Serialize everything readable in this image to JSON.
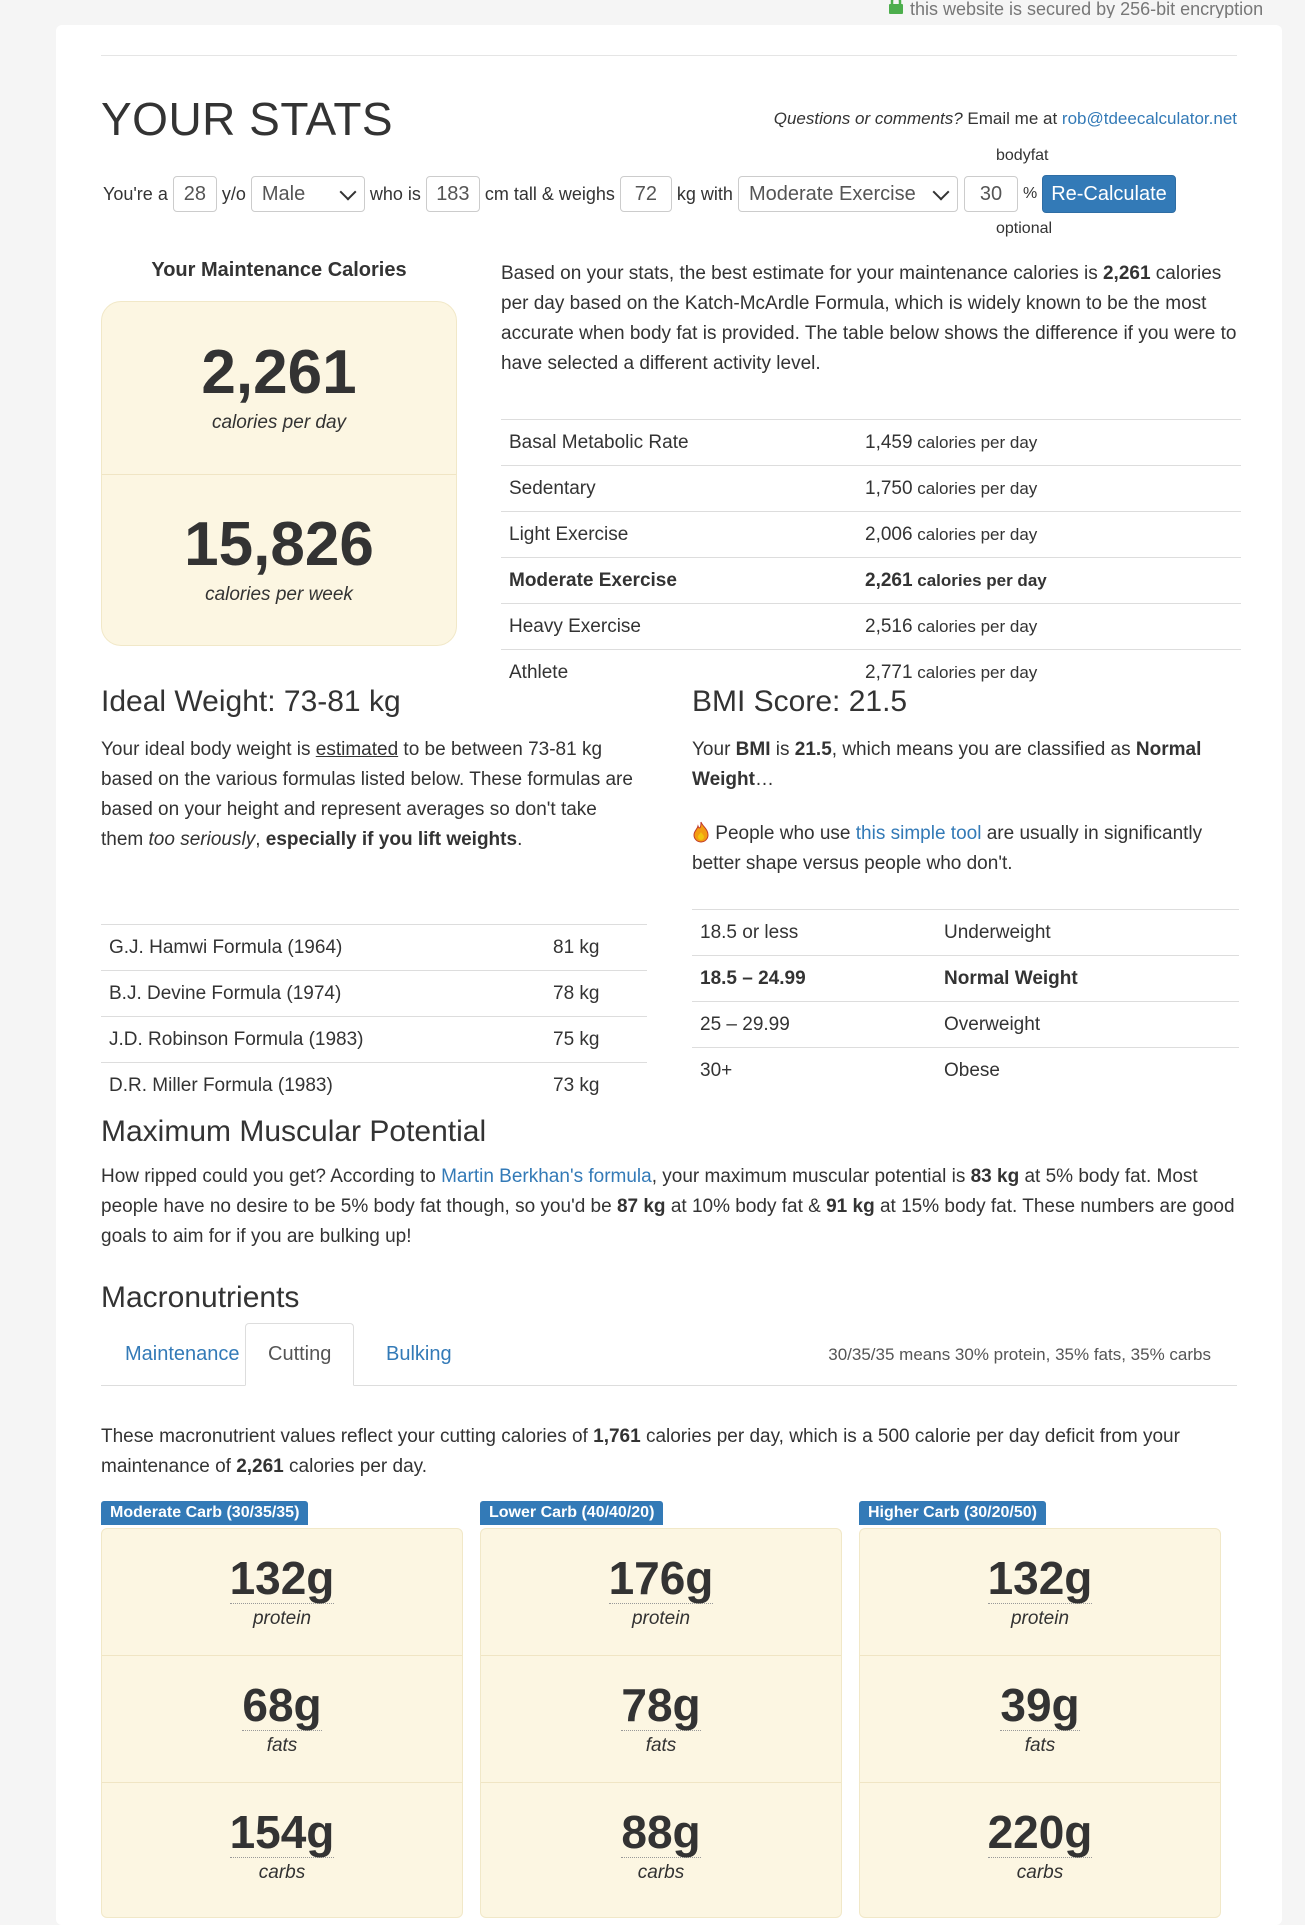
{
  "secure_text": "this website is secured by 256-bit encryption",
  "header": {
    "title": "YOUR STATS",
    "contact_italic": "Questions or comments?",
    "contact_text": " Email me at ",
    "contact_email": "rob@tdeecalculator.net"
  },
  "form": {
    "youre_a": "You're a",
    "age": "28",
    "yo": "y/o",
    "gender": "Male",
    "who_is": "who is",
    "height": "183",
    "cm_tall": "cm tall & weighs",
    "weight": "72",
    "kg_with": "kg with",
    "activity": "Moderate Exercise",
    "bodyfat_label": "bodyfat",
    "bodyfat": "30",
    "percent": "%",
    "optional_label": "optional",
    "recalc_label": "Re-Calculate"
  },
  "maintenance": {
    "title": "Your Maintenance Calories",
    "per_day": "2,261",
    "per_day_label": "calories per day",
    "per_week": "15,826",
    "per_week_label": "calories per week",
    "intro_1": "Based on your stats, the best estimate for your maintenance calories is ",
    "intro_bold": "2,261",
    "intro_2": " calories per day based on the Katch-McArdle Formula, which is widely known to be the most accurate when body fat is provided. The table below shows the difference if you were to have selected a different activity level.",
    "rows": [
      {
        "name": "Basal Metabolic Rate",
        "value": "1,459",
        "unit": " calories per day"
      },
      {
        "name": "Sedentary",
        "value": "1,750",
        "unit": " calories per day"
      },
      {
        "name": "Light Exercise",
        "value": "2,006",
        "unit": " calories per day"
      },
      {
        "name": "Moderate Exercise",
        "value": "2,261",
        "unit": " calories per day"
      },
      {
        "name": "Heavy Exercise",
        "value": "2,516",
        "unit": " calories per day"
      },
      {
        "name": "Athlete",
        "value": "2,771",
        "unit": " calories per day"
      }
    ]
  },
  "ideal": {
    "title": "Ideal Weight: 73-81 kg",
    "p1": "Your ideal body weight is ",
    "p_estimated": "estimated",
    "p2": " to be between 73-81 kg based on the various formulas listed below. These formulas are based on your height and represent averages so don't take them ",
    "p_italic": "too seriously",
    "p3": ", ",
    "p_bold": "especially if you lift weights",
    "p4": ".",
    "rows": [
      {
        "name": "G.J. Hamwi Formula (1964)",
        "value": "81 kg"
      },
      {
        "name": "B.J. Devine Formula (1974)",
        "value": "78 kg"
      },
      {
        "name": "J.D. Robinson Formula (1983)",
        "value": "75 kg"
      },
      {
        "name": "D.R. Miller Formula (1983)",
        "value": "73 kg"
      }
    ]
  },
  "bmi": {
    "title": "BMI Score: 21.5",
    "p1": "Your ",
    "p_bmi": "BMI",
    "p2": " is ",
    "p_score": "21.5",
    "p3": ", which means you are classified as ",
    "p_class": "Normal Weight",
    "p4": "…",
    "tool_1": " People who use ",
    "tool_link": "this simple tool",
    "tool_2": " are usually in significantly better shape versus people who don't.",
    "rows": [
      {
        "range": "18.5 or less",
        "label": "Underweight"
      },
      {
        "range": "18.5 – 24.99",
        "label": "Normal Weight"
      },
      {
        "range": "25 – 29.99",
        "label": "Overweight"
      },
      {
        "range": "30+",
        "label": "Obese"
      }
    ]
  },
  "muscular": {
    "title": "Maximum Muscular Potential",
    "p1": "How ripped could you get? According to ",
    "p_link": "Martin Berkhan's formula",
    "p2": ", your maximum muscular potential is ",
    "v1": "83 kg",
    "p3": " at 5% body fat. Most people have no desire to be 5% body fat though, so you'd be ",
    "v2": "87 kg",
    "p4": " at 10% body fat & ",
    "v3": "91 kg",
    "p5": " at 15% body fat. These numbers are good goals to aim for if you are bulking up!"
  },
  "macros": {
    "title": "Macronutrients",
    "tabs": [
      "Maintenance",
      "Cutting",
      "Bulking"
    ],
    "tab_note": "30/35/35 means 30% protein, 35% fats, 35% carbs",
    "p1": "These macronutrient values reflect your cutting calories of ",
    "b1": "1,761",
    "p2": " calories per day, which is a 500 calorie per day deficit from your maintenance of ",
    "b2": "2,261",
    "p3": " calories per day.",
    "columns": [
      {
        "label": "Moderate Carb (30/35/35)",
        "protein": "132g",
        "fats": "68g",
        "carbs": "154g"
      },
      {
        "label": "Lower Carb (40/40/20)",
        "protein": "176g",
        "fats": "78g",
        "carbs": "88g"
      },
      {
        "label": "Higher Carb (30/20/50)",
        "protein": "132g",
        "fats": "39g",
        "carbs": "220g"
      }
    ],
    "protein_label": "protein",
    "fats_label": "fats",
    "carbs_label": "carbs"
  }
}
